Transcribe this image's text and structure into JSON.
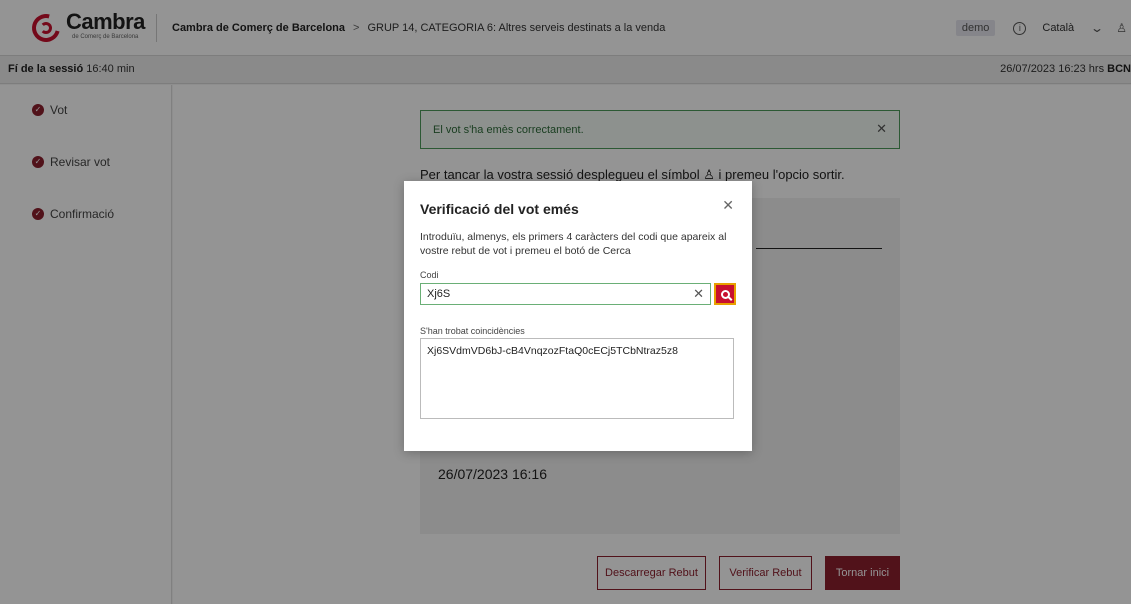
{
  "header": {
    "logo_name": "Cambra",
    "logo_sub": "de Comerç de Barcelona",
    "breadcrumb_root": "Cambra de Comerç de Barcelona",
    "breadcrumb_sep": ">",
    "breadcrumb_current": "GRUP 14, CATEGORIA 6: Altres serveis destinats a la venda",
    "demo_label": "demo",
    "info_icon": "info-icon",
    "language": "Català",
    "user_icon": "user-icon"
  },
  "session": {
    "end_label": "Fí de la sessió",
    "end_time": "16:40 min",
    "datetime": "26/07/2023 16:23 hrs",
    "timezone": "BCN"
  },
  "sidebar": {
    "steps": [
      {
        "label": "Vot"
      },
      {
        "label": "Revisar vot"
      },
      {
        "label": "Confirmació"
      }
    ]
  },
  "main": {
    "alert_text": "El vot s'ha emès correctament.",
    "session_message": "Per tancar la vostra sessió desplegueu el símbol ♙ i premeu l'opcio sortir.",
    "vote_date": "26/07/2023 16:16",
    "buttons": {
      "download": "Descarregar Rebut",
      "verify": "Verificar Rebut",
      "home": "Tornar inici"
    }
  },
  "modal": {
    "title": "Verificació del vot emés",
    "description": "Introduïu, almenys, els primers 4 caràcters del codi que apareix al vostre rebut de vot i premeu el botó de Cerca",
    "code_label": "Codi",
    "code_value": "Xj6S",
    "results_label": "S'han trobat coincidències",
    "results": [
      "Xj6SVdmVD6bJ-cB4VnqzozFtaQ0cECj5TCbNtraz5z8"
    ]
  },
  "colors": {
    "brand": "#c8102e",
    "accent": "#8c1f2e",
    "success_border": "#4c9a5b"
  }
}
